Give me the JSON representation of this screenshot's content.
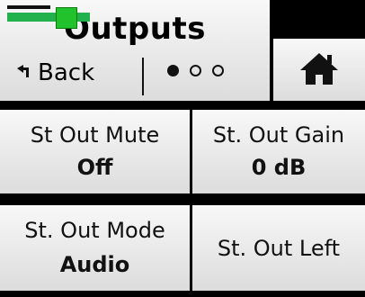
{
  "header": {
    "title": "Outputs",
    "back_label": "Back",
    "back_icon": "return-arrow-icon",
    "page_indicator": {
      "total": 3,
      "current": 1
    }
  },
  "home": {
    "icon": "home-icon"
  },
  "buttons": [
    {
      "label": "St Out Mute",
      "value": "Off"
    },
    {
      "label": "St. Out Gain",
      "value": "0 dB"
    },
    {
      "label": "St. Out Mode",
      "value": "Audio"
    },
    {
      "label": "St. Out Left",
      "value": ""
    }
  ],
  "colors": {
    "meter_green": "#22b14c",
    "background": "#000000"
  }
}
